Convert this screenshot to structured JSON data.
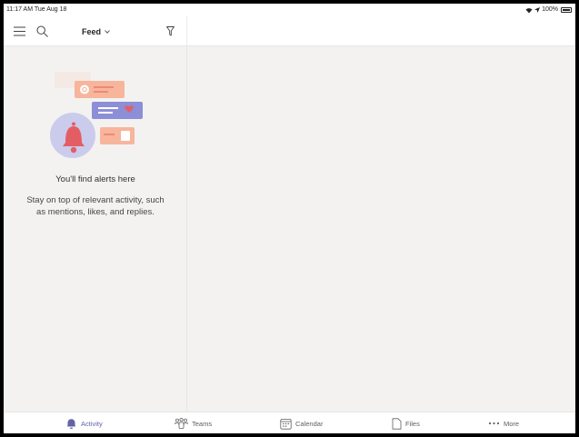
{
  "status_bar": {
    "time_date": "11:17 AM  Tue Aug 18",
    "battery": "100%",
    "icons": [
      "wifi-icon",
      "location-icon",
      "battery-icon"
    ]
  },
  "header": {
    "icons": [
      "hamburger-menu-icon",
      "search-icon",
      "chevron-down-icon",
      "filter-icon"
    ],
    "title": "Feed"
  },
  "empty_state": {
    "title": "You'll find alerts here",
    "description": "Stay on top of relevant activity, such as mentions, likes, and replies."
  },
  "tabs": [
    {
      "label": "Activity",
      "icon": "bell-icon",
      "active": true
    },
    {
      "label": "Teams",
      "icon": "teams-icon",
      "active": false
    },
    {
      "label": "Calendar",
      "icon": "calendar-icon",
      "active": false
    },
    {
      "label": "Files",
      "icon": "file-icon",
      "active": false
    },
    {
      "label": "More",
      "icon": "more-dots-icon",
      "active": false
    }
  ],
  "colors": {
    "accent": "#6264a7",
    "background": "#f3f2f1",
    "bell": "#e35e64",
    "bubble_salmon": "#f7b59c",
    "bubble_purple": "#8c8ed8",
    "bell_circle": "#cbcbeb"
  }
}
